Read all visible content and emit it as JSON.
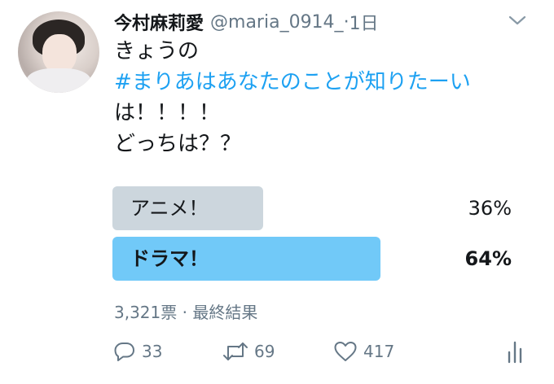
{
  "tweet": {
    "display_name": "今村麻莉愛",
    "handle": "@maria_0914_",
    "separator": "·",
    "time": "1日",
    "text": {
      "line1": "きょうの",
      "hashtag": "#まりあはあなたのことが知りたーい",
      "line3": "は！！！！",
      "line4": "どっちは？？"
    }
  },
  "poll": {
    "options": [
      {
        "label": "アニメ！",
        "percent": "36%",
        "value": 36,
        "winner": false
      },
      {
        "label": "ドラマ！",
        "percent": "64%",
        "value": 64,
        "winner": true
      }
    ],
    "meta": "3,321票 · 最終結果"
  },
  "actions": {
    "reply_count": "33",
    "retweet_count": "69",
    "like_count": "417"
  },
  "colors": {
    "accent": "#1da1f2",
    "winner_bar": "#71c9f8",
    "loser_bar": "#ccd6dd",
    "muted_text": "#657786"
  },
  "icons": [
    "avatar",
    "chevron-down-icon",
    "reply-icon",
    "retweet-icon",
    "like-icon",
    "analytics-icon"
  ]
}
